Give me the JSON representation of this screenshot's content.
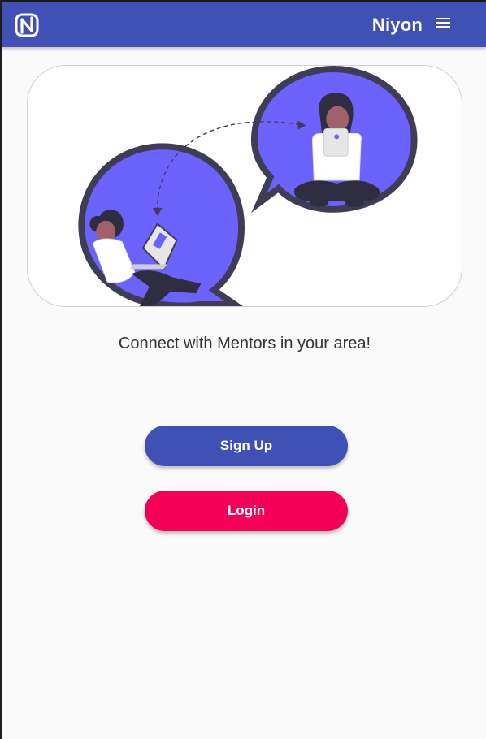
{
  "header": {
    "brand": "Niyon",
    "logo_icon": "niyon-logo-icon",
    "menu_icon": "hamburger-menu-icon"
  },
  "hero": {
    "illustration": "mentoring-chat-bubbles-illustration"
  },
  "main": {
    "tagline": "Connect with Mentors in your area!"
  },
  "actions": {
    "signup_label": "Sign Up",
    "login_label": "Login"
  },
  "colors": {
    "primary": "#3f51b5",
    "accent": "#f50057",
    "bubble": "#6c63ff",
    "bubble_outline": "#3f3d56"
  }
}
